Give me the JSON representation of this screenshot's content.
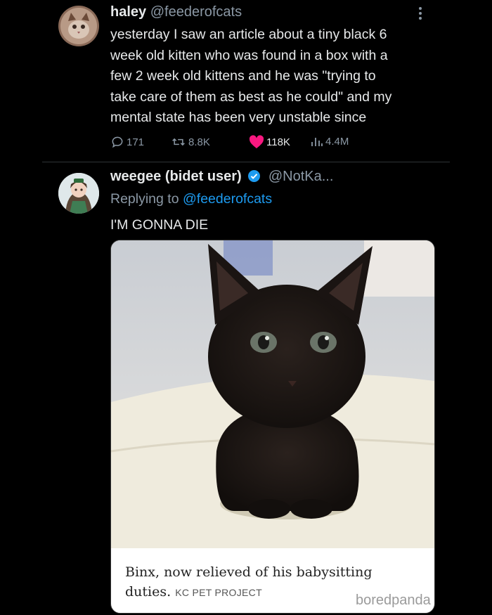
{
  "tweet1": {
    "name": "haley",
    "handle": "@feederofcats",
    "lines": [
      "yesterday I saw an article about a tiny black 6",
      "week old kitten who was found in a box with a",
      "few 2 week old kittens and he was \"trying to",
      "take care of them as best as he could\" and my",
      "mental state has been very unstable since"
    ],
    "more_icon": "more-dots-icon",
    "stats": {
      "replies": "171",
      "reposts": "8.8K",
      "likes": "118K",
      "views": "4.4M"
    },
    "colors": {
      "like": "#f91880"
    }
  },
  "tweet2": {
    "name": "weegee (bidet user)",
    "handle": "@NotKa...",
    "replying_prefix": "Replying to",
    "replying_handle": "@feederofcats",
    "text": "I'M GONNA DIE",
    "card": {
      "caption": "Binx, now relieved of his babysitting duties.",
      "credit": "KC PET PROJECT"
    },
    "colors": {
      "verified": "#1d9bf0",
      "link": "#1d9bf0"
    }
  },
  "watermark": "boredpanda"
}
